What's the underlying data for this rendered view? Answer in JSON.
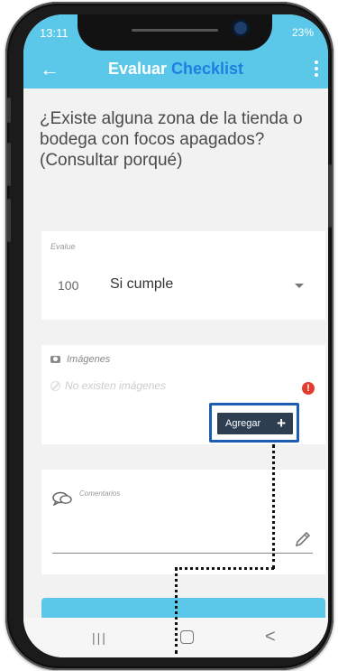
{
  "status": {
    "time": "13:11",
    "battery": "23%"
  },
  "header": {
    "back_icon": "arrow-left",
    "title_main": "Evaluar",
    "title_accent": "Checklist",
    "menu_icon": "more-vertical"
  },
  "question": "¿Existe alguna zona de la tienda o bodega con focos apagados? (Consultar porqué)",
  "evalue": {
    "label": "Evalue",
    "score": "100",
    "selected": "Si cumple"
  },
  "images": {
    "label": "Imágenes",
    "empty_text": "No existen imágenes",
    "alert": "!",
    "add_label": "Agregar",
    "add_icon": "plus"
  },
  "comments": {
    "label": "Comentarios",
    "edit_icon": "pencil"
  },
  "nav": {
    "recents": "|||",
    "back": "<"
  },
  "colors": {
    "header": "#5bc8ea",
    "accent": "#1f7fe0",
    "add_button": "#2c3e50",
    "alert": "#e53b2f",
    "highlight_frame": "#1a5fb4"
  }
}
